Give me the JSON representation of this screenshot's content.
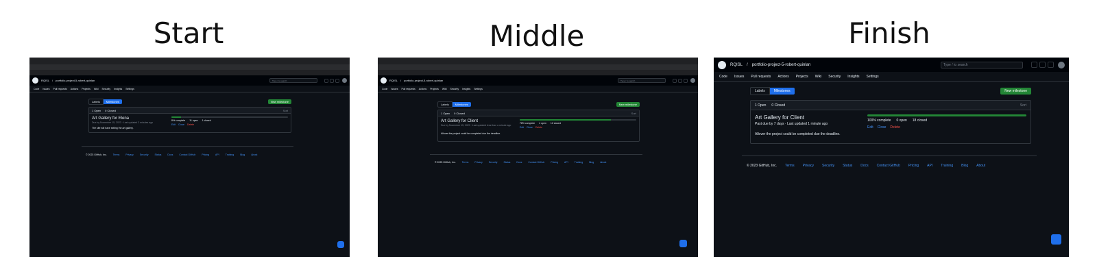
{
  "titles": {
    "start": "Start",
    "middle": "Middle",
    "finish": "Finish"
  },
  "repo": {
    "owner": "RQISL",
    "name": "portfolio-project-5-robert-quinlan"
  },
  "nav": [
    "Code",
    "Issues",
    "Pull requests",
    "Actions",
    "Projects",
    "Wiki",
    "Security",
    "Insights",
    "Settings"
  ],
  "search_placeholder": "Type / to search",
  "buttons": {
    "labels": "Labels",
    "milestones": "Milestones",
    "new_milestone": "New milestone"
  },
  "list_header": {
    "open": "1 Open",
    "closed": "0 Closed",
    "sort": "Sort"
  },
  "actions": {
    "edit": "Edit",
    "close": "Close",
    "delete": "Delete"
  },
  "footer": {
    "copyright": "© 2023 GitHub, Inc.",
    "links": [
      "Terms",
      "Privacy",
      "Security",
      "Status",
      "Docs",
      "Contact GitHub",
      "Pricing",
      "API",
      "Training",
      "Blog",
      "About"
    ]
  },
  "start": {
    "milestone": "Art Gallery for Elena",
    "meta": "Due by November 15, 2023 · Last updated 2 minutes ago",
    "desc": "The site will have selling the art gallery.",
    "progress": 0.08,
    "complete": "8% complete",
    "open": "11 open",
    "closed": "1 closed"
  },
  "middle": {
    "milestone": "Art Gallery for Client",
    "meta": "Due by November 15, 2023 · Last updated less than a minute ago",
    "desc": "Allover the project could be completed due the deadline.",
    "progress": 0.78,
    "complete": "78% complete",
    "open": "4 open",
    "closed": "12 closed"
  },
  "finish": {
    "milestone": "Art Gallery for Client",
    "meta": "Past due by 7 days · Last updated 1 minute ago",
    "desc": "Allover the project could be completed due the deadline.",
    "progress": 1.0,
    "complete": "100% complete",
    "open": "0 open",
    "closed": "18 closed"
  }
}
